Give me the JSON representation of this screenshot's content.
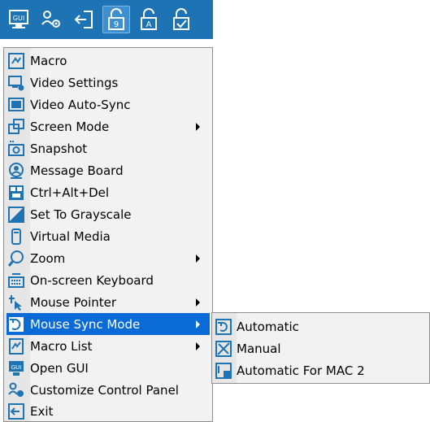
{
  "toolbar": {
    "buttons": [
      {
        "name": "gui-icon",
        "label": "GUI"
      },
      {
        "name": "customize-panel-icon"
      },
      {
        "name": "exit-icon"
      },
      {
        "name": "hotkey-9-icon",
        "label": "9"
      },
      {
        "name": "hotkey-a-icon",
        "label": "A"
      },
      {
        "name": "hotkey-check-icon"
      }
    ],
    "active_index": 3
  },
  "menu": {
    "items": [
      {
        "label": "Macro",
        "icon": "macro-icon",
        "submenu": false
      },
      {
        "label": "Video Settings",
        "icon": "video-settings-icon",
        "submenu": false
      },
      {
        "label": "Video Auto-Sync",
        "icon": "video-auto-sync-icon",
        "submenu": false
      },
      {
        "label": "Screen Mode",
        "icon": "screen-mode-icon",
        "submenu": true
      },
      {
        "label": "Snapshot",
        "icon": "snapshot-icon",
        "submenu": false
      },
      {
        "label": "Message Board",
        "icon": "message-board-icon",
        "submenu": false
      },
      {
        "label": "Ctrl+Alt+Del",
        "icon": "ctrl-alt-del-icon",
        "submenu": false
      },
      {
        "label": "Set To Grayscale",
        "icon": "grayscale-icon",
        "submenu": false
      },
      {
        "label": "Virtual Media",
        "icon": "virtual-media-icon",
        "submenu": false
      },
      {
        "label": "Zoom",
        "icon": "zoom-icon",
        "submenu": true
      },
      {
        "label": "On-screen Keyboard",
        "icon": "keyboard-icon",
        "submenu": false
      },
      {
        "label": "Mouse Pointer",
        "icon": "mouse-pointer-icon",
        "submenu": true
      },
      {
        "label": "Mouse Sync Mode",
        "icon": "mouse-sync-icon",
        "submenu": true
      },
      {
        "label": "Macro List",
        "icon": "macro-list-icon",
        "submenu": true
      },
      {
        "label": "Open GUI",
        "icon": "open-gui-icon",
        "submenu": false
      },
      {
        "label": "Customize Control Panel",
        "icon": "customize-icon",
        "submenu": false
      },
      {
        "label": "Exit",
        "icon": "exit-icon",
        "submenu": false
      }
    ],
    "selected_index": 12
  },
  "submenu": {
    "items": [
      {
        "label": "Automatic",
        "icon": "automatic-sync-icon"
      },
      {
        "label": "Manual",
        "icon": "manual-sync-icon"
      },
      {
        "label": "Automatic For MAC 2",
        "icon": "mac-sync-icon"
      }
    ]
  },
  "colors": {
    "toolbar_bg": "#1e73b5",
    "menu_bg": "#f2f2f2",
    "selected_bg": "#0a6bd6",
    "icon_blue": "#1e73b5"
  }
}
